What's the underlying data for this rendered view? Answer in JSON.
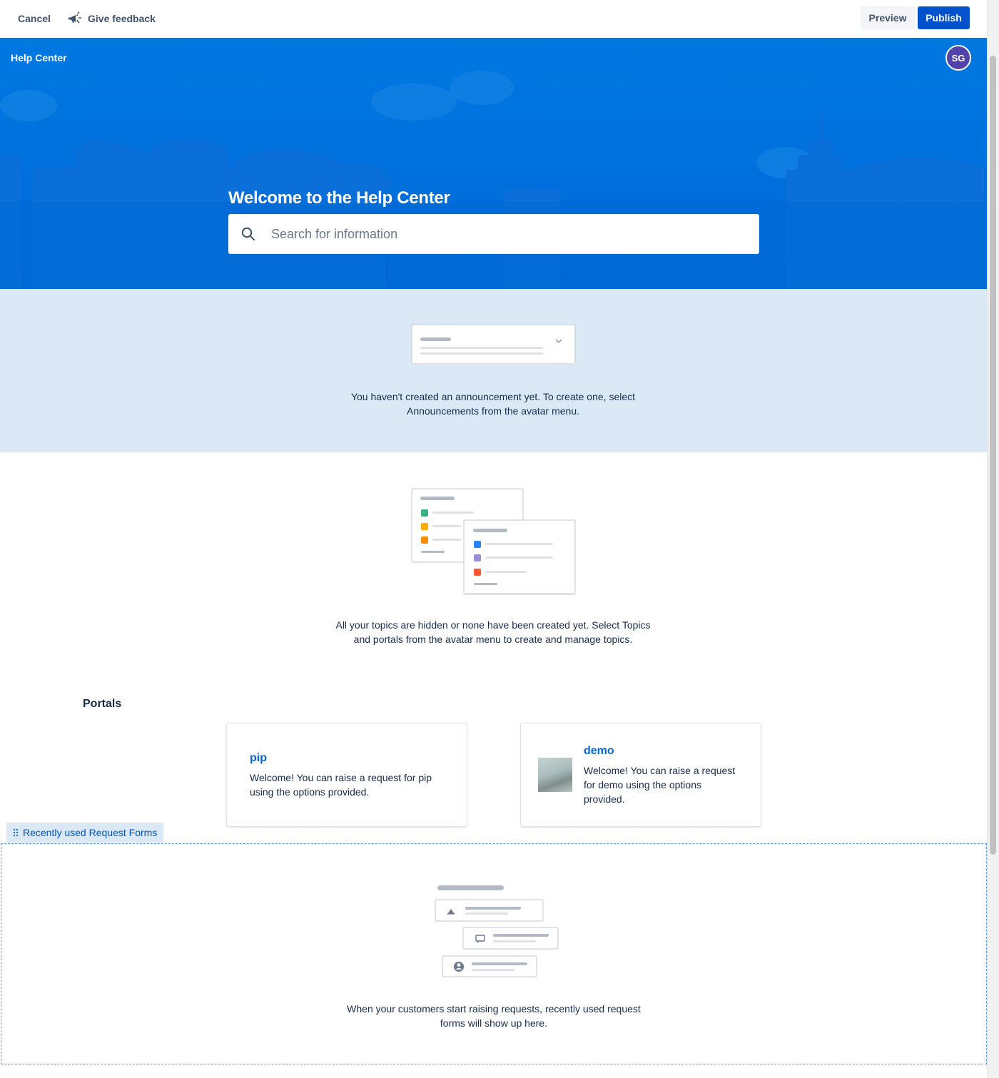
{
  "toolbar": {
    "cancel_label": "Cancel",
    "feedback_label": "Give feedback",
    "preview_label": "Preview",
    "publish_label": "Publish"
  },
  "colors": {
    "primary": "#0052cc",
    "hero_blue": "#0071de",
    "avatar_purple": "#5243aa",
    "announcement_bg": "#dbe9f7",
    "link_blue": "#0065d8"
  },
  "hero": {
    "site_title": "Help Center",
    "avatar_initials": "SG",
    "welcome_title": "Welcome to the Help Center",
    "search_placeholder": "Search for information"
  },
  "announcement": {
    "empty_line1": "You haven't created an announcement yet. To create one, select",
    "empty_line2": "Announcements from the avatar menu."
  },
  "topics": {
    "empty_line1": "All your topics are hidden or none have been created yet. Select Topics",
    "empty_line2": "and portals from the avatar menu to create and manage topics."
  },
  "portals": {
    "heading": "Portals",
    "items": [
      {
        "name": "pip",
        "desc_line1": "Welcome! You can raise a request for pip",
        "desc_line2": "using the options provided."
      },
      {
        "name": "demo",
        "desc_line1": "Welcome! You can raise a request",
        "desc_line2": "for demo using the options",
        "desc_line3": "provided."
      }
    ]
  },
  "recent_forms": {
    "tag_label": "Recently used Request Forms",
    "empty_line1": "When your customers start raising requests, recently used request",
    "empty_line2": "forms will show up here."
  },
  "icons": {
    "feedback": "megaphone-icon",
    "search": "search-icon",
    "drag": "drag-handle-icon"
  }
}
